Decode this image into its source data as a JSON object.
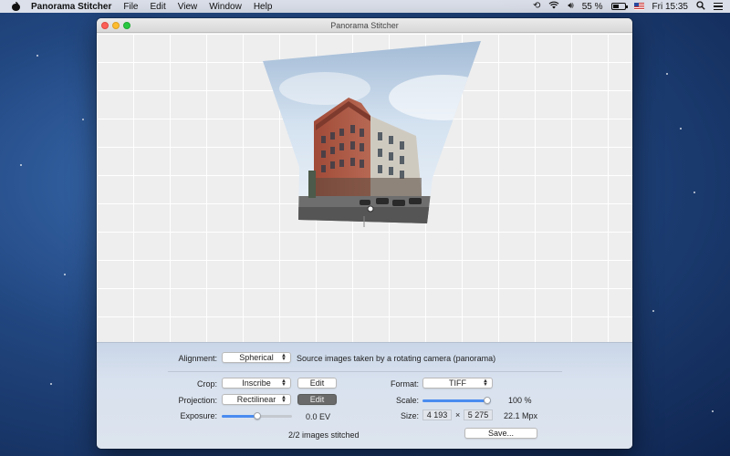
{
  "menubar": {
    "app_name": "Panorama Stitcher",
    "menus": [
      "File",
      "Edit",
      "View",
      "Window",
      "Help"
    ],
    "battery_text": "55 %",
    "battery_level": 0.55,
    "clock": "Fri 15:35"
  },
  "window": {
    "title": "Panorama Stitcher"
  },
  "controls": {
    "alignment": {
      "label": "Alignment:",
      "value": "Spherical",
      "description": "Source images taken by a rotating camera (panorama)"
    },
    "crop": {
      "label": "Crop:",
      "value": "Inscribe",
      "edit_label": "Edit"
    },
    "projection": {
      "label": "Projection:",
      "value": "Rectilinear",
      "edit_label": "Edit"
    },
    "exposure": {
      "label": "Exposure:",
      "value": "0.0 EV",
      "slider_level": 0.5
    },
    "format": {
      "label": "Format:",
      "value": "TIFF"
    },
    "scale": {
      "label": "Scale:",
      "value": "100 %",
      "slider_level": 1.0
    },
    "size": {
      "label": "Size:",
      "width": "4 193",
      "separator": "×",
      "height": "5 275",
      "megapixels": "22.1 Mpx"
    },
    "status": "2/2 images stitched",
    "save_label": "Save..."
  },
  "colors": {
    "accent": "#4a8cf0",
    "close": "#fc5f57",
    "minimize": "#fdbc2e",
    "maximize": "#28c840"
  }
}
